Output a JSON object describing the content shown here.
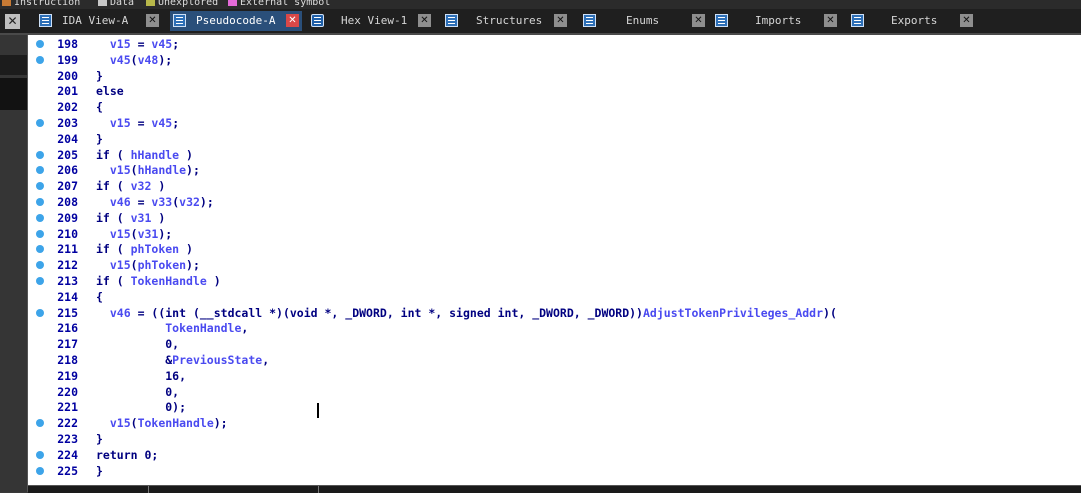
{
  "legend": [
    {
      "label": "Instruction",
      "color": "#c77a34"
    },
    {
      "label": "Data",
      "color": "#c8c8c8"
    },
    {
      "label": "Unexplored",
      "color": "#b8b84a"
    },
    {
      "label": "External symbol",
      "color": "#e46ad8"
    }
  ],
  "tabs": [
    {
      "label": "IDA View-A",
      "icon": "ida-view-icon",
      "active": false
    },
    {
      "label": "Pseudocode-A",
      "icon": "pseudocode-icon",
      "active": true
    },
    {
      "label": "Hex View-1",
      "icon": "hex-view-icon",
      "active": false
    },
    {
      "label": "Structures",
      "icon": "structures-icon",
      "active": false
    },
    {
      "label": "Enums",
      "icon": "enums-icon",
      "active": false
    },
    {
      "label": "Imports",
      "icon": "imports-icon",
      "active": false
    },
    {
      "label": "Exports",
      "icon": "exports-icon",
      "active": false
    }
  ],
  "code_lines": [
    {
      "num": "198",
      "dot": true,
      "text": "  v15 = v45;"
    },
    {
      "num": "199",
      "dot": true,
      "text": "  v45(v48);"
    },
    {
      "num": "200",
      "dot": false,
      "text": "}"
    },
    {
      "num": "201",
      "dot": false,
      "text": "else"
    },
    {
      "num": "202",
      "dot": false,
      "text": "{"
    },
    {
      "num": "203",
      "dot": true,
      "text": "  v15 = v45;"
    },
    {
      "num": "204",
      "dot": false,
      "text": "}"
    },
    {
      "num": "205",
      "dot": true,
      "text": "if ( hHandle )"
    },
    {
      "num": "206",
      "dot": true,
      "text": "  v15(hHandle);"
    },
    {
      "num": "207",
      "dot": true,
      "text": "if ( v32 )"
    },
    {
      "num": "208",
      "dot": true,
      "text": "  v46 = v33(v32);"
    },
    {
      "num": "209",
      "dot": true,
      "text": "if ( v31 )"
    },
    {
      "num": "210",
      "dot": true,
      "text": "  v15(v31);"
    },
    {
      "num": "211",
      "dot": true,
      "text": "if ( phToken )"
    },
    {
      "num": "212",
      "dot": true,
      "text": "  v15(phToken);"
    },
    {
      "num": "213",
      "dot": true,
      "text": "if ( TokenHandle )"
    },
    {
      "num": "214",
      "dot": false,
      "text": "{"
    },
    {
      "num": "215",
      "dot": true,
      "text": "  v46 = ((int (__stdcall *)(void *, _DWORD, int *, signed int, _DWORD, _DWORD))AdjustTokenPrivileges_Addr)("
    },
    {
      "num": "216",
      "dot": false,
      "text": "          TokenHandle,"
    },
    {
      "num": "217",
      "dot": false,
      "text": "          0,"
    },
    {
      "num": "218",
      "dot": false,
      "text": "          &PreviousState,"
    },
    {
      "num": "219",
      "dot": false,
      "text": "          16,"
    },
    {
      "num": "220",
      "dot": false,
      "text": "          0,"
    },
    {
      "num": "221",
      "dot": false,
      "text": "          0);"
    },
    {
      "num": "222",
      "dot": true,
      "text": "  v15(TokenHandle);"
    },
    {
      "num": "223",
      "dot": false,
      "text": "}"
    },
    {
      "num": "224",
      "dot": true,
      "text": "return 0;"
    },
    {
      "num": "225",
      "dot": true,
      "text": "}"
    }
  ],
  "colors": {
    "line_number": "#0000a0",
    "code": "#000080",
    "variable": "#4a4af0",
    "breakpoint_dot": "#3da4e9",
    "active_tab": "#2a4f7a"
  }
}
